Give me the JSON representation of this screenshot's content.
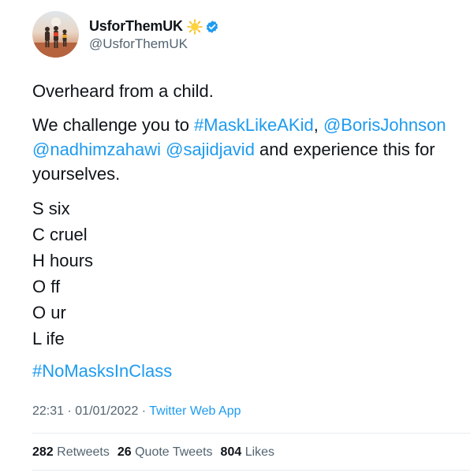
{
  "author": {
    "display_name": "UsforThemUK",
    "handle": "@UsforThemUK",
    "verified": true,
    "badge_icon": "sun-emoji-icon"
  },
  "tweet": {
    "intro": "Overheard from a child.",
    "challenge": {
      "text_before": "We challenge you to ",
      "hashtag": "#MaskLikeAKid",
      "comma": ", ",
      "mention1": "@BorisJohnson",
      "mention2": "@nadhimzahawi",
      "space": " ",
      "mention3": "@sajidjavid",
      "text_after": " and experience this for yourselves."
    },
    "acronym_lines": [
      "S six",
      "C cruel",
      "H hours",
      "O ff",
      "O ur",
      "L ife"
    ],
    "closing_hashtag": "#NoMasksInClass"
  },
  "meta": {
    "time": "22:31",
    "sep": " · ",
    "date": "01/01/2022",
    "sep2": " · ",
    "source": "Twitter Web App"
  },
  "stats": {
    "retweets_count": "282",
    "retweets_label": "Retweets",
    "quotes_count": "26",
    "quotes_label": "Quote Tweets",
    "likes_count": "804",
    "likes_label": "Likes"
  },
  "colors": {
    "link": "#1d9bf0",
    "secondary": "#536471",
    "text": "#0f1419",
    "divider": "#e6ecf0"
  }
}
